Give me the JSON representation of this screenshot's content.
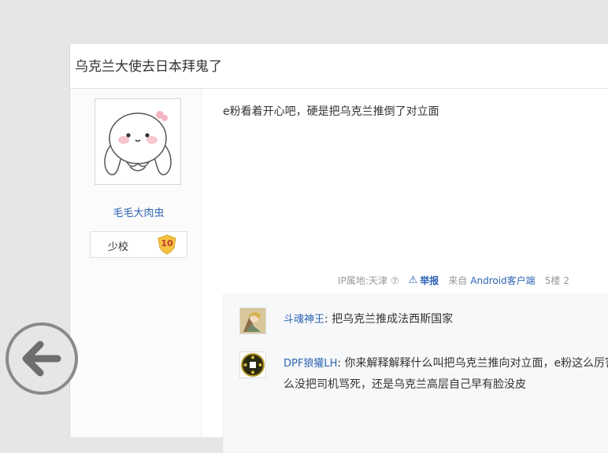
{
  "thread": {
    "title": "乌克兰大使去日本拜鬼了"
  },
  "post": {
    "author": {
      "name": "毛毛大肉虫",
      "rank": "少校",
      "level": "10"
    },
    "content": "e粉看着开心吧，硬是把乌克兰推倒了对立面",
    "tail": {
      "ip": "IP属地:天津",
      "report": "举报",
      "client_prefix": "来自",
      "client": "Android客户端",
      "floor": "5楼",
      "floor_tail": "2"
    }
  },
  "comments": [
    {
      "user": "斗魂神王",
      "sep": ": ",
      "text": "把乌克兰推成法西斯国家"
    },
    {
      "user": "DPF狼獾LH",
      "sep": ": ",
      "text": "你来解释解释什么叫把乌克兰推向对立面，e粉这么厉害怎么没把司机骂死，还是乌克兰高层自己早有脸没皮"
    }
  ]
}
